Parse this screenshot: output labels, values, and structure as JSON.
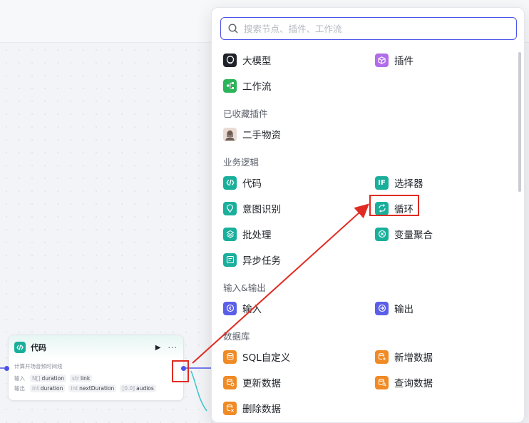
{
  "code_node": {
    "title": "代码",
    "run_icon": "▶",
    "more_icon": "···",
    "description": "计算开场音频时间线",
    "input_label": "输入",
    "output_label": "输出",
    "inputs": [
      {
        "type": "N[]",
        "name": "duration"
      },
      {
        "type": "str",
        "name": "link"
      }
    ],
    "outputs": [
      {
        "type": "int",
        "name": "duration"
      },
      {
        "type": "int",
        "name": "nextDuration"
      },
      {
        "type": "[0.0]",
        "name": "audios"
      }
    ]
  },
  "popup": {
    "search_placeholder": "搜索节点、插件、工作流",
    "top_items": [
      {
        "label": "大模型",
        "icon": "llm-icon",
        "color": "#1f2329"
      },
      {
        "label": "插件",
        "icon": "plugin-icon",
        "color": "#b16ee8"
      },
      {
        "label": "工作流",
        "icon": "workflow-icon",
        "color": "#2bb45a"
      }
    ],
    "sections": {
      "favorites": "已收藏插件",
      "logic": "业务逻辑",
      "io": "输入&输出",
      "database": "数据库"
    },
    "favorites": [
      {
        "label": "二手物资",
        "icon": "avatar-icon"
      }
    ],
    "logic_items": [
      {
        "label": "代码",
        "icon": "code-icon",
        "color": "#1aaf9b"
      },
      {
        "label": "选择器",
        "icon": "if-icon",
        "color": "#1aaf9b"
      },
      {
        "label": "意图识别",
        "icon": "lightbulb-icon",
        "color": "#1aaf9b"
      },
      {
        "label": "循环",
        "icon": "loop-icon",
        "color": "#1aaf9b"
      },
      {
        "label": "批处理",
        "icon": "layers-icon",
        "color": "#1aaf9b"
      },
      {
        "label": "变量聚合",
        "icon": "aggregate-icon",
        "color": "#1aaf9b"
      },
      {
        "label": "异步任务",
        "icon": "async-task-icon",
        "color": "#1aaf9b"
      }
    ],
    "io_items": [
      {
        "label": "输入",
        "icon": "input-icon",
        "color": "#5b5fe8"
      },
      {
        "label": "输出",
        "icon": "output-icon",
        "color": "#5b5fe8"
      }
    ],
    "db_items": [
      {
        "label": "SQL自定义",
        "icon": "sql-icon",
        "color": "#f08a24"
      },
      {
        "label": "新增数据",
        "icon": "db-add-icon",
        "color": "#f08a24"
      },
      {
        "label": "更新数据",
        "icon": "db-update-icon",
        "color": "#f08a24"
      },
      {
        "label": "查询数据",
        "icon": "db-query-icon",
        "color": "#f08a24"
      },
      {
        "label": "删除数据",
        "icon": "db-delete-icon",
        "color": "#f08a24"
      }
    ]
  },
  "annotation": {
    "color": "#e02b22"
  }
}
